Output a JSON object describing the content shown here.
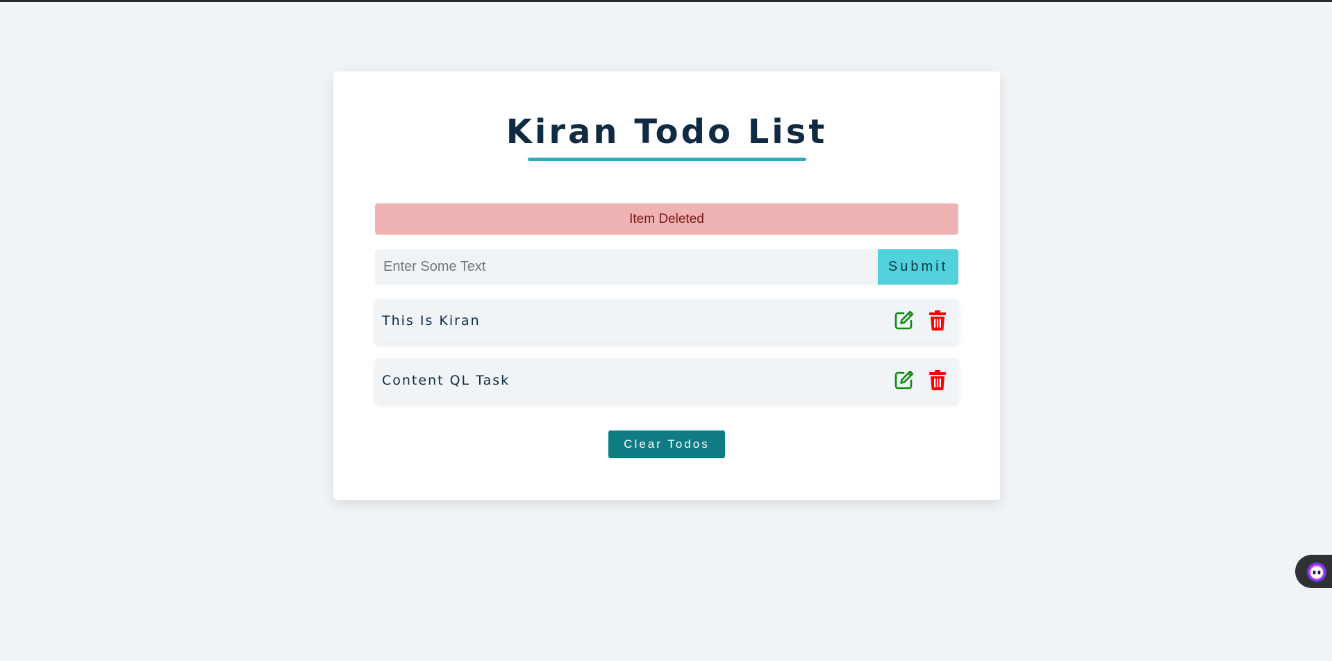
{
  "app": {
    "title": "Kiran Todo List"
  },
  "alert": {
    "text": "Item Deleted"
  },
  "form": {
    "input_value": "",
    "input_placeholder": "Enter Some Text",
    "submit_label": "Submit"
  },
  "todos": [
    {
      "text": "This Is Kiran",
      "edit_icon": "edit-icon",
      "delete_icon": "trash-icon"
    },
    {
      "text": "Content QL Task",
      "edit_icon": "edit-icon",
      "delete_icon": "trash-icon"
    }
  ],
  "actions": {
    "clear_label": "Clear Todos"
  },
  "widget": {
    "icon": "chat-assistant-icon"
  },
  "colors": {
    "title": "#102a43",
    "accent_underline": "#2caab9",
    "alert_bg": "#f0b3b3",
    "alert_text": "#7a1414",
    "submit_bg": "#50d1db",
    "edit_icon": "#0a8a0a",
    "delete_icon": "#ff0000",
    "clear_button": "#0f7c84"
  }
}
